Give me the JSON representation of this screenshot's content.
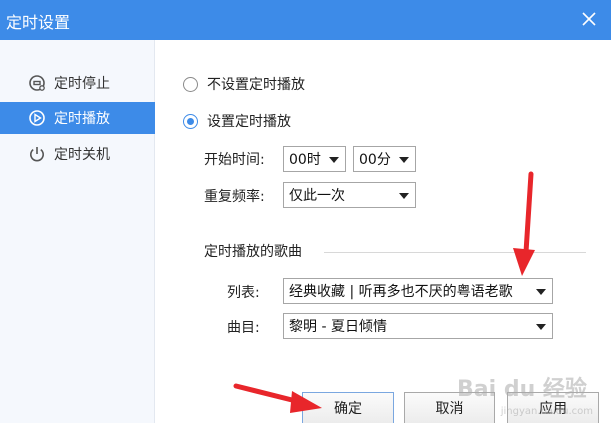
{
  "window": {
    "title": "定时设置"
  },
  "sidebar": {
    "items": [
      {
        "label": "定时停止",
        "icon": "pause-circle-icon",
        "active": false
      },
      {
        "label": "定时播放",
        "icon": "play-circle-icon",
        "active": true
      },
      {
        "label": "定时关机",
        "icon": "power-icon",
        "active": false
      }
    ]
  },
  "options": {
    "no_schedule_label": "不设置定时播放",
    "schedule_label": "设置定时播放",
    "selected": "schedule"
  },
  "schedule": {
    "start_time_label": "开始时间:",
    "hour_value": "00时",
    "minute_value": "00分",
    "repeat_label": "重复频率:",
    "repeat_value": "仅此一次"
  },
  "songs": {
    "section_title": "定时播放的歌曲",
    "list_label": "列表:",
    "list_value": "经典收藏 | 听再多也不厌的粤语老歌",
    "track_label": "曲目:",
    "track_value": "黎明 - 夏日倾情"
  },
  "buttons": {
    "ok": "确定",
    "cancel": "取消",
    "apply": "应用"
  },
  "watermark": {
    "text": "Bai du 经验",
    "sub": "jingyan.baidu.com"
  },
  "colors": {
    "accent": "#3d8be8",
    "annotation_arrow": "#e8262b"
  }
}
